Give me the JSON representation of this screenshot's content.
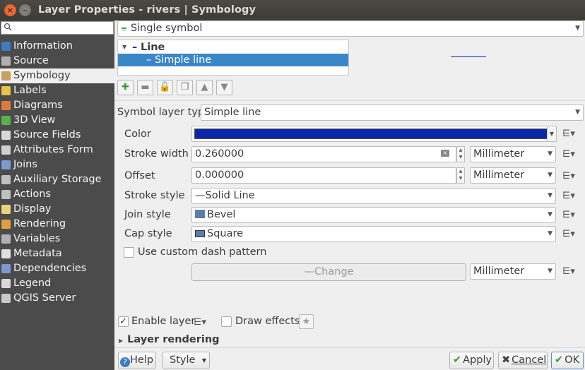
{
  "window": {
    "title": "Layer Properties - rivers | Symbology"
  },
  "search": {
    "placeholder": ""
  },
  "sidebar": {
    "items": [
      {
        "label": "Information",
        "icon": "info-icon",
        "color": "#3d7bc0"
      },
      {
        "label": "Source",
        "icon": "settings-icon",
        "color": "#b0b0b0"
      },
      {
        "label": "Symbology",
        "icon": "paintbrush-icon",
        "color": "#c8a060"
      },
      {
        "label": "Labels",
        "icon": "labels-icon",
        "color": "#e8c34a"
      },
      {
        "label": "Diagrams",
        "icon": "diagram-icon",
        "color": "#e07a3a"
      },
      {
        "label": "3D View",
        "icon": "cube-icon",
        "color": "#5ab04a"
      },
      {
        "label": "Source Fields",
        "icon": "table-icon",
        "color": "#d8d8d8"
      },
      {
        "label": "Attributes Form",
        "icon": "form-icon",
        "color": "#d0d0d0"
      },
      {
        "label": "Joins",
        "icon": "join-icon",
        "color": "#7a9ad0"
      },
      {
        "label": "Auxiliary Storage",
        "icon": "storage-icon",
        "color": "#c0c0c0"
      },
      {
        "label": "Actions",
        "icon": "gear-icon",
        "color": "#c0c0c0"
      },
      {
        "label": "Display",
        "icon": "speech-bubble-icon",
        "color": "#e8d27a"
      },
      {
        "label": "Rendering",
        "icon": "brush-icon",
        "color": "#e0a040"
      },
      {
        "label": "Variables",
        "icon": "variables-icon",
        "color": "#b0b0b0"
      },
      {
        "label": "Metadata",
        "icon": "metadata-icon",
        "color": "#e0e0e0"
      },
      {
        "label": "Dependencies",
        "icon": "dependencies-icon",
        "color": "#7a9ad0"
      },
      {
        "label": "Legend",
        "icon": "legend-icon",
        "color": "#d8d8d8"
      },
      {
        "label": "QGIS Server",
        "icon": "server-icon",
        "color": "#c8c8c8"
      }
    ],
    "active_index": 2
  },
  "renderer": {
    "value": "Single symbol"
  },
  "tree": {
    "parent": "Line",
    "child": "Simple line"
  },
  "symbol_layer_type": {
    "label": "Symbol layer type",
    "value": "Simple line"
  },
  "props": {
    "color_label": "Color",
    "color_value": "#0a27a8",
    "stroke_width_label": "Stroke width",
    "stroke_width_value": "0.260000",
    "stroke_width_unit": "Millimeter",
    "offset_label": "Offset",
    "offset_value": "0.000000",
    "offset_unit": "Millimeter",
    "stroke_style_label": "Stroke style",
    "stroke_style_value": "Solid Line",
    "join_style_label": "Join style",
    "join_style_value": "Bevel",
    "cap_style_label": "Cap style",
    "cap_style_value": "Square",
    "custom_dash_label": "Use custom dash pattern",
    "change_label": "Change",
    "change_unit": "Millimeter"
  },
  "bottom": {
    "enable_layer": "Enable layer",
    "draw_effects": "Draw effects",
    "layer_rendering": "Layer rendering"
  },
  "footer": {
    "help": "Help",
    "style": "Style",
    "apply": "Apply",
    "cancel": "Cancel",
    "ok": "OK"
  }
}
